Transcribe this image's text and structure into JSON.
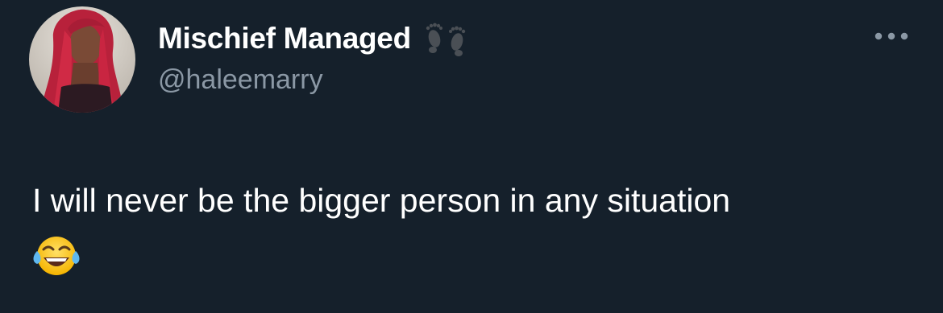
{
  "tweet": {
    "author": {
      "display_name": "Mischief Managed",
      "handle": "@haleemarry",
      "name_decoration_icon": "footprints-icon",
      "avatar_icon": "avatar"
    },
    "more_icon": "more-options-icon",
    "text": "I will never be the bigger person in any situation",
    "emoji": {
      "char": "😂",
      "icon": "face-with-tears-of-joy-icon"
    }
  },
  "colors": {
    "background": "#15202b",
    "primary_text": "#ffffff",
    "secondary_text": "#8b98a5",
    "avatar_hair": "#c0203a"
  }
}
